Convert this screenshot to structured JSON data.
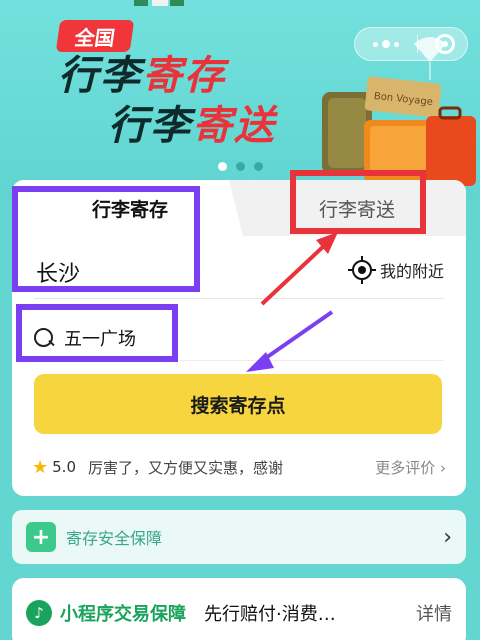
{
  "banner": {
    "badge": "全国",
    "slogan_line1_dark": "行李",
    "slogan_line1_red": "寄存",
    "slogan_line2_dark": "行李",
    "slogan_line2_red": "寄送",
    "luggage_tag": "Bon Voyage"
  },
  "tabs": [
    {
      "label": "行李寄存",
      "active": true
    },
    {
      "label": "行李寄送",
      "active": false
    }
  ],
  "location": {
    "city": "长沙",
    "nearby_label": "我的附近"
  },
  "search": {
    "query": "五一广场",
    "button_label": "搜索寄存点"
  },
  "review": {
    "score": "5.0",
    "text": "厉害了，又方便又实惠，感谢",
    "more_label": "更多评价",
    "more_chevron": "›"
  },
  "safety": {
    "label": "寄存安全保障",
    "chevron": "›"
  },
  "guarantee": {
    "title": "小程序交易保障",
    "description": "先行赔付·消费…",
    "detail_label": "详情"
  },
  "colors": {
    "banner_bg": "#63d6d2",
    "accent_yellow": "#f7d53e",
    "brand_red": "#e8333a",
    "annotation_purple": "#7b3ff2",
    "annotation_red": "#e8333a",
    "guarantee_green": "#1aa35a"
  }
}
